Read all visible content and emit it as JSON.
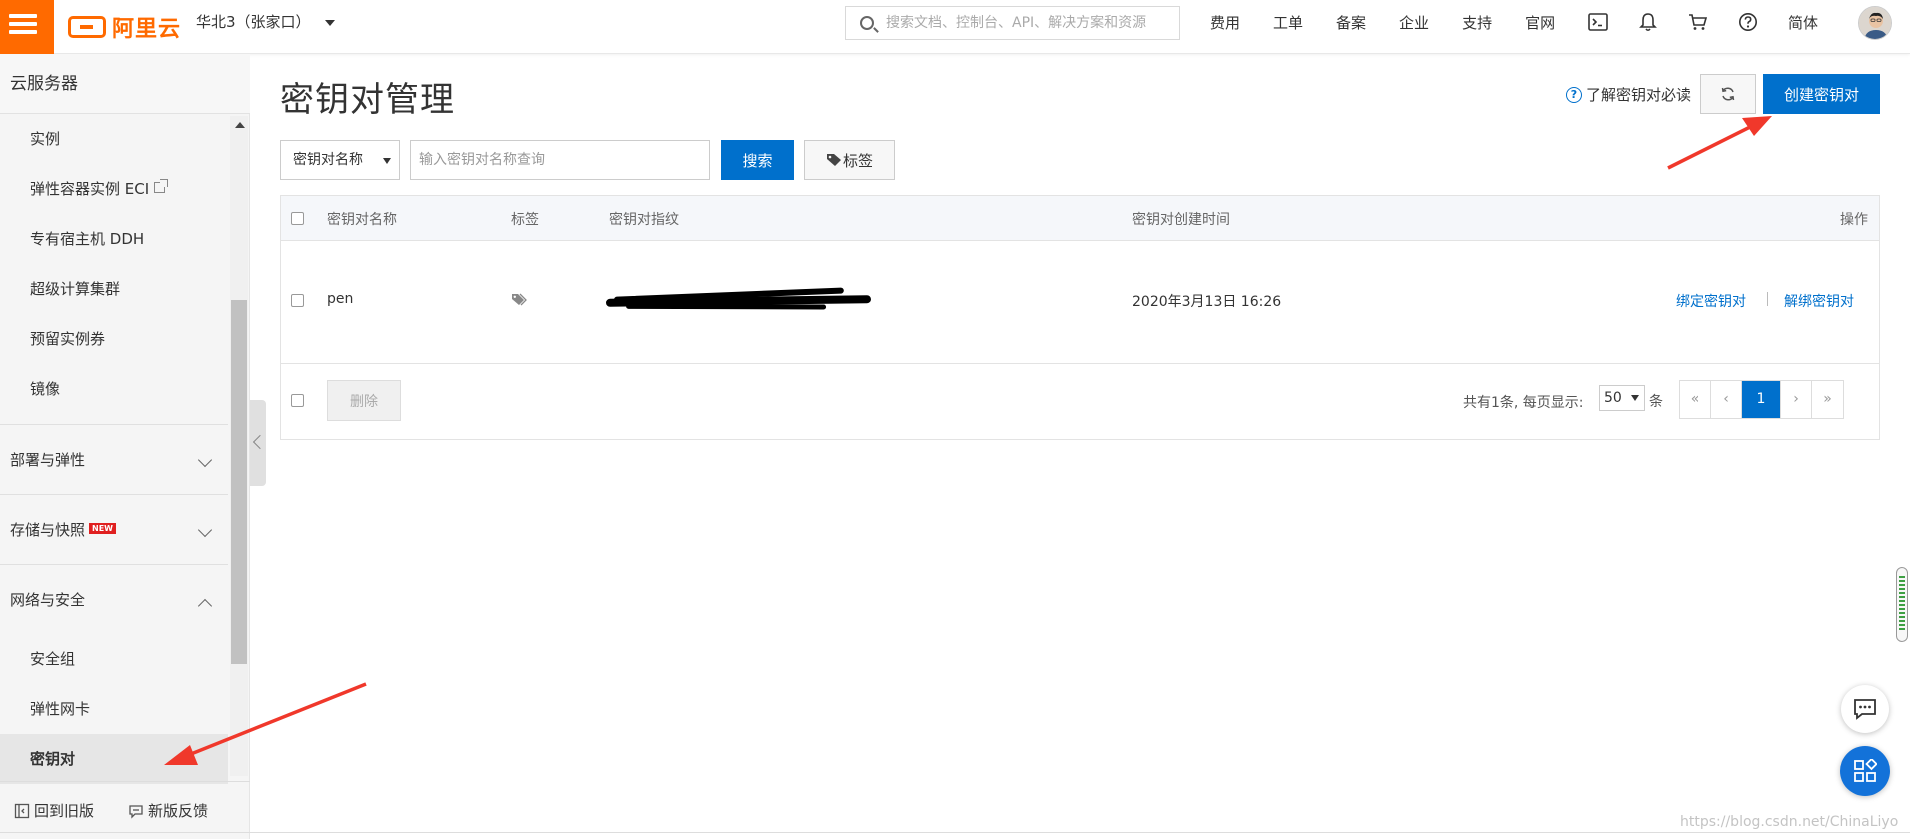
{
  "header": {
    "brand_name": "阿里云",
    "region": "华北3（张家口）",
    "search_placeholder": "搜索文档、控制台、API、解决方案和资源",
    "nav": [
      "费用",
      "工单",
      "备案",
      "企业",
      "支持",
      "官网"
    ],
    "language": "简体",
    "icons": [
      "terminal-icon",
      "bell-icon",
      "cart-icon",
      "help-icon"
    ]
  },
  "sidebar": {
    "title": "云服务器",
    "items": [
      "实例",
      "弹性容器实例 ECI",
      "专有宿主机 DDH",
      "超级计算集群",
      "预留实例券",
      "镜像"
    ],
    "groups": {
      "deploy": "部署与弹性",
      "storage": "存储与快照",
      "storage_badge": "NEW",
      "network": "网络与安全"
    },
    "network_items": [
      "安全组",
      "弹性网卡",
      "密钥对"
    ],
    "active": "密钥对",
    "footer": {
      "old_version": "回到旧版",
      "feedback": "新版反馈"
    }
  },
  "page": {
    "title": "密钥对管理",
    "help_link": "了解密钥对必读",
    "create_button": "创建密钥对",
    "filter": {
      "field": "密钥对名称",
      "placeholder": "输入密钥对名称查询",
      "search_button": "搜索",
      "tag_button": "标签"
    }
  },
  "table": {
    "columns": [
      "密钥对名称",
      "标签",
      "密钥对指纹",
      "密钥对创建时间",
      "操作"
    ],
    "rows": [
      {
        "name": "pen",
        "fingerprint": "",
        "created": "2020年3月13日 16:26",
        "actions": [
          "绑定密钥对",
          "解绑密钥对"
        ]
      }
    ],
    "footer": {
      "delete_button": "删除",
      "total_text": "共有1条, 每页显示:",
      "page_size": "50",
      "unit": "条",
      "pager": [
        "«",
        "‹",
        "1",
        "›",
        "»"
      ],
      "current_page": "1"
    }
  },
  "watermark": "https://blog.csdn.net/ChinaLiyo",
  "colors": {
    "brand": "#ff6a00",
    "primary": "#0070cc",
    "annotation": "#f0382b"
  }
}
